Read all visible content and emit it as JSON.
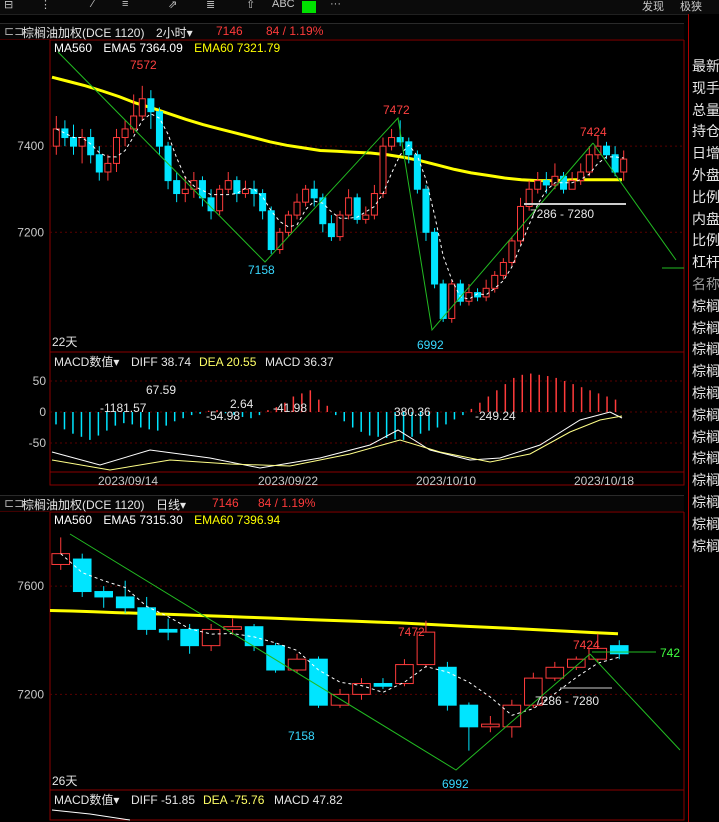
{
  "toolbar": {
    "right_items": [
      "发现",
      "极狭"
    ],
    "dots": "···",
    "abc": "ABC"
  },
  "pane1": {
    "symbol": "棕榈油加权(DCE 1120)",
    "period": "2小时▾",
    "price": "7146",
    "change": "84 / 1.19%",
    "ma560": "MA560",
    "ema5_label": "EMA5 7364.09",
    "ema60_label": "EMA60 7321.79",
    "y_ticks": [
      {
        "v": 7400,
        "label": "7400"
      },
      {
        "v": 7200,
        "label": "7200"
      }
    ],
    "days_label": "22天",
    "annotations": [
      {
        "text": "7572",
        "color": "#ff4040"
      },
      {
        "text": "7472",
        "color": "#ff4040"
      },
      {
        "text": "7424",
        "color": "#ff4040"
      },
      {
        "text": "7158",
        "color": "#38d8ff"
      },
      {
        "text": "6992",
        "color": "#38d8ff"
      },
      {
        "text": "7286 - 7280",
        "color": "#e6e6e6"
      }
    ],
    "macd_title": "MACD数值▾",
    "diff": "DIFF 38.74",
    "dea": "DEA 20.55",
    "macd": "MACD 36.37",
    "macd_ticks": [
      "50",
      "0",
      "-50"
    ],
    "macd_labels": [
      "67.59",
      "-1181.57",
      "2.64",
      "-54.98",
      "-41.98",
      "380.36",
      "-249.24"
    ],
    "dates": [
      "2023/09/14",
      "2023/09/22",
      "2023/10/10",
      "2023/10/18"
    ]
  },
  "pane2": {
    "symbol": "棕榈油加权(DCE 1120)",
    "period": "日线▾",
    "price": "7146",
    "change": "84 / 1.19%",
    "ma560": "MA560",
    "ema5_label": "EMA5 7315.30",
    "ema60_label": "EMA60 7396.94",
    "y_ticks": [
      {
        "v": 7600,
        "label": "7600"
      },
      {
        "v": 7200,
        "label": "7200"
      }
    ],
    "days_label": "26天",
    "right_price": "742",
    "annotations": [
      {
        "text": "7472",
        "color": "#ff4040"
      },
      {
        "text": "7424",
        "color": "#ff4040"
      },
      {
        "text": "7158",
        "color": "#38d8ff"
      },
      {
        "text": "6992",
        "color": "#38d8ff"
      },
      {
        "text": "7286 - 7280",
        "color": "#e6e6e6"
      }
    ],
    "macd_title": "MACD数值▾",
    "diff": "DIFF -51.85",
    "dea": "DEA -75.76",
    "macd": "MACD 47.82"
  },
  "sidebar": {
    "items": [
      "最新",
      "现手",
      "总量",
      "持仓",
      "日增",
      "外盘",
      "比例",
      "内盘",
      "比例",
      "杠杆",
      "名称",
      "棕榈",
      "棕榈",
      "棕榈",
      "棕榈",
      "棕榈",
      "棕榈",
      "棕榈",
      "棕榈",
      "棕榈",
      "棕榈",
      "棕榈",
      "棕榈"
    ]
  },
  "colors": {
    "up": "#ff3b3b",
    "down": "#00e5ff",
    "ema60": "#ffff00",
    "trend": "#22bb22",
    "grid": "#5a0000"
  },
  "chart_data": [
    {
      "type": "candlestick",
      "title": "棕榈油加权(DCE 1120) 2小时",
      "ylim": [
        6950,
        7600
      ],
      "candles": [
        [
          7400,
          7440,
          7470,
          7380
        ],
        [
          7440,
          7420,
          7460,
          7400
        ],
        [
          7420,
          7400,
          7450,
          7380
        ],
        [
          7400,
          7420,
          7440,
          7360
        ],
        [
          7420,
          7380,
          7440,
          7360
        ],
        [
          7380,
          7340,
          7400,
          7320
        ],
        [
          7340,
          7360,
          7380,
          7320
        ],
        [
          7360,
          7420,
          7440,
          7340
        ],
        [
          7420,
          7440,
          7460,
          7400
        ],
        [
          7440,
          7470,
          7520,
          7430
        ],
        [
          7470,
          7510,
          7540,
          7460
        ],
        [
          7510,
          7480,
          7530,
          7440
        ],
        [
          7480,
          7400,
          7490,
          7380
        ],
        [
          7400,
          7320,
          7410,
          7300
        ],
        [
          7320,
          7290,
          7340,
          7270
        ],
        [
          7290,
          7300,
          7330,
          7270
        ],
        [
          7300,
          7320,
          7340,
          7280
        ],
        [
          7320,
          7280,
          7330,
          7260
        ],
        [
          7280,
          7250,
          7300,
          7230
        ],
        [
          7250,
          7300,
          7310,
          7240
        ],
        [
          7300,
          7320,
          7340,
          7290
        ],
        [
          7320,
          7290,
          7330,
          7270
        ],
        [
          7290,
          7300,
          7320,
          7280
        ],
        [
          7300,
          7290,
          7320,
          7260
        ],
        [
          7290,
          7250,
          7300,
          7230
        ],
        [
          7250,
          7160,
          7260,
          7150
        ],
        [
          7160,
          7200,
          7210,
          7150
        ],
        [
          7200,
          7240,
          7250,
          7190
        ],
        [
          7240,
          7270,
          7290,
          7230
        ],
        [
          7270,
          7300,
          7310,
          7260
        ],
        [
          7300,
          7280,
          7320,
          7260
        ],
        [
          7280,
          7220,
          7290,
          7200
        ],
        [
          7220,
          7190,
          7240,
          7180
        ],
        [
          7190,
          7240,
          7250,
          7180
        ],
        [
          7240,
          7280,
          7300,
          7230
        ],
        [
          7280,
          7230,
          7290,
          7220
        ],
        [
          7230,
          7240,
          7260,
          7220
        ],
        [
          7240,
          7290,
          7310,
          7230
        ],
        [
          7290,
          7400,
          7420,
          7280
        ],
        [
          7400,
          7420,
          7440,
          7390
        ],
        [
          7420,
          7410,
          7460,
          7400
        ],
        [
          7410,
          7380,
          7420,
          7360
        ],
        [
          7380,
          7300,
          7390,
          7290
        ],
        [
          7300,
          7200,
          7310,
          7180
        ],
        [
          7200,
          7080,
          7210,
          7070
        ],
        [
          7080,
          7000,
          7090,
          6992
        ],
        [
          7000,
          7080,
          7090,
          6990
        ],
        [
          7080,
          7040,
          7090,
          7030
        ],
        [
          7040,
          7060,
          7080,
          7030
        ],
        [
          7060,
          7050,
          7070,
          7040
        ],
        [
          7050,
          7070,
          7090,
          7040
        ],
        [
          7070,
          7100,
          7110,
          7060
        ],
        [
          7100,
          7130,
          7140,
          7090
        ],
        [
          7130,
          7180,
          7190,
          7120
        ],
        [
          7180,
          7260,
          7280,
          7170
        ],
        [
          7260,
          7300,
          7320,
          7250
        ],
        [
          7300,
          7320,
          7340,
          7290
        ],
        [
          7320,
          7310,
          7340,
          7290
        ],
        [
          7310,
          7330,
          7360,
          7300
        ],
        [
          7330,
          7300,
          7340,
          7290
        ],
        [
          7300,
          7320,
          7340,
          7300
        ],
        [
          7320,
          7340,
          7360,
          7310
        ],
        [
          7340,
          7380,
          7400,
          7330
        ],
        [
          7380,
          7400,
          7424,
          7370
        ],
        [
          7400,
          7380,
          7410,
          7370
        ],
        [
          7380,
          7340,
          7400,
          7330
        ],
        [
          7340,
          7370,
          7390,
          7320
        ]
      ],
      "ema60": [
        7560,
        7550,
        7540,
        7528,
        7515,
        7500,
        7488,
        7475,
        7462,
        7450,
        7440,
        7430,
        7420,
        7410,
        7402,
        7396,
        7390,
        7388,
        7386,
        7384,
        7380,
        7374,
        7366,
        7356,
        7346,
        7338,
        7332,
        7326,
        7322,
        7320,
        7320,
        7322,
        7322,
        7322,
        7322
      ],
      "macd_hist": [
        -20,
        -28,
        -35,
        -40,
        -45,
        -38,
        -30,
        -22,
        -18,
        -20,
        -25,
        -28,
        -30,
        -22,
        -15,
        -10,
        -5,
        -3,
        2,
        3,
        -2,
        -5,
        -8,
        -10,
        -5,
        3,
        8,
        15,
        25,
        30,
        35,
        20,
        10,
        -5,
        -15,
        -25,
        -32,
        -38,
        -40,
        -42,
        -44,
        -45,
        -40,
        -35,
        -30,
        -25,
        -20,
        -12,
        -5,
        5,
        15,
        25,
        35,
        45,
        55,
        60,
        62,
        60,
        58,
        55,
        50,
        45,
        40,
        35,
        30,
        25,
        20
      ]
    },
    {
      "type": "candlestick",
      "title": "棕榈油加权(DCE 1120) 日线",
      "ylim": [
        6950,
        7800
      ],
      "candles": [
        [
          7680,
          7720,
          7780,
          7660
        ],
        [
          7700,
          7580,
          7720,
          7560
        ],
        [
          7580,
          7560,
          7600,
          7520
        ],
        [
          7560,
          7520,
          7620,
          7500
        ],
        [
          7520,
          7440,
          7560,
          7420
        ],
        [
          7440,
          7430,
          7480,
          7400
        ],
        [
          7440,
          7380,
          7460,
          7350
        ],
        [
          7380,
          7440,
          7460,
          7360
        ],
        [
          7440,
          7450,
          7480,
          7420
        ],
        [
          7450,
          7380,
          7460,
          7360
        ],
        [
          7380,
          7290,
          7390,
          7280
        ],
        [
          7290,
          7330,
          7350,
          7280
        ],
        [
          7330,
          7160,
          7340,
          7150
        ],
        [
          7160,
          7200,
          7220,
          7150
        ],
        [
          7200,
          7240,
          7260,
          7180
        ],
        [
          7240,
          7230,
          7260,
          7220
        ],
        [
          7240,
          7310,
          7330,
          7230
        ],
        [
          7310,
          7430,
          7472,
          7300
        ],
        [
          7300,
          7160,
          7320,
          7140
        ],
        [
          7160,
          7080,
          7170,
          6992
        ],
        [
          7080,
          7090,
          7120,
          7060
        ],
        [
          7080,
          7160,
          7180,
          7040
        ],
        [
          7160,
          7260,
          7280,
          7150
        ],
        [
          7260,
          7300,
          7320,
          7250
        ],
        [
          7300,
          7330,
          7340,
          7290
        ],
        [
          7330,
          7370,
          7424,
          7320
        ],
        [
          7380,
          7350,
          7400,
          7330
        ]
      ],
      "ema60": [
        7510,
        7508,
        7505,
        7502,
        7500,
        7497,
        7494,
        7491,
        7488,
        7485,
        7482,
        7479,
        7476,
        7473,
        7470,
        7467,
        7464,
        7460,
        7456,
        7452,
        7448,
        7444,
        7440,
        7436,
        7432,
        7428,
        7424
      ]
    }
  ]
}
